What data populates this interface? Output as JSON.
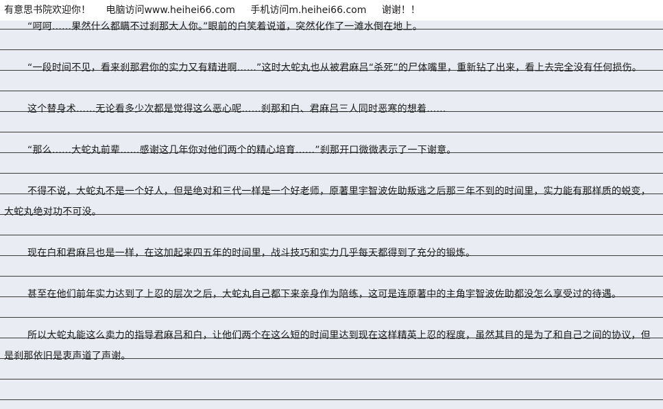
{
  "header": {
    "welcome": "有意思书院欢迎你！",
    "pc_visit": "电脑访问www.heihei66.com",
    "mobile_visit": "手机访问m.heihei66.com",
    "thanks": "谢谢！！"
  },
  "story": {
    "paragraphs": [
      "“呵呵……果然什么都瞒不过刹那大人你。”眼前的白笑着说道，突然化作了一滩水倒在地上。",
      "“一段时间不见，看来刹那君你的实力又有精进啊……”这时大蛇丸也从被君麻吕“杀死”的尸体嘴里，重新钻了出来，看上去完全没有任何损伤。",
      "这个替身术……无论看多少次都是觉得这么恶心呢……刹那和白、君麻吕三人同时恶寒的想着……",
      "“那么……大蛇丸前辈……感谢这几年你对他们两个的精心培育……”刹那开口微微表示了一下谢意。",
      "不得不说，大蛇丸不是一个好人，但是绝对和三代一样是一个好老师，原著里宇智波佐助叛逃之后那三年不到的时间里，实力能有那样质的蜕变，大蛇丸绝对功不可没。",
      "现在白和君麻吕也是一样，在这加起来四五年的时间里，战斗技巧和实力几乎每天都得到了充分的锻炼。",
      "甚至在他们前年实力达到了上忍的层次之后，大蛇丸自己都下来亲身作为陪练，这可是连原著中的主角宇智波佐助都没怎么享受过的待遇。",
      "所以大蛇丸能这么卖力的指导君麻吕和白，让他们两个在这么短的时间里达到现在这样精英上忍的程度，虽然其目的是为了和自己之间的协议，但是刹那依旧是衷声道了声谢。"
    ]
  }
}
